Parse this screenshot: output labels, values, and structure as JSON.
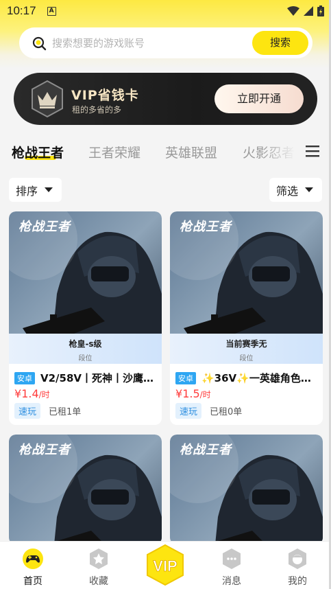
{
  "status_bar": {
    "time": "10:17",
    "notification_letter": "A"
  },
  "search": {
    "placeholder": "搜索想要的游戏账号",
    "button_label": "搜索"
  },
  "vip_card": {
    "title": "VIP省钱卡",
    "subtitle": "租的多省的多",
    "button_label": "立即开通"
  },
  "tabs": [
    {
      "label": "枪战王者",
      "active": true
    },
    {
      "label": "王者荣耀",
      "active": false
    },
    {
      "label": "英雄联盟",
      "active": false
    },
    {
      "label": "火影忍者",
      "active": false
    }
  ],
  "filters": {
    "sort_label": "排序",
    "filter_label": "筛选"
  },
  "cards": [
    {
      "cover_text": "枪战王者",
      "banner_title": "枪皇-s级",
      "banner_sub": "段位",
      "os": "安卓",
      "title": "V2/58V丨死神丨沙鹰…",
      "price_symbol": "¥",
      "price": "1.4",
      "price_unit": "/时",
      "tag": "速玩",
      "rented": "已租1单"
    },
    {
      "cover_text": "枪战王者",
      "banner_title": "当前赛季无",
      "banner_sub": "段位",
      "os": "安卓",
      "title": "✨36V✨一英雄角色…",
      "price_symbol": "¥",
      "price": "1.5",
      "price_unit": "/时",
      "tag": "速玩",
      "rented": "已租0单"
    },
    {
      "cover_text": "枪战王者"
    },
    {
      "cover_text": "枪战王者"
    }
  ],
  "bottom_nav": [
    {
      "label": "首页",
      "icon": "gamepad-icon",
      "active": true
    },
    {
      "label": "收藏",
      "icon": "star-icon",
      "active": false
    },
    {
      "label": "VIP",
      "icon": "vip-badge-icon",
      "active": false
    },
    {
      "label": "消息",
      "icon": "chat-bubble-icon",
      "active": false
    },
    {
      "label": "我的",
      "icon": "profile-face-icon",
      "active": false
    }
  ],
  "colors": {
    "accent_yellow": "#fde510",
    "price_red": "#ff3b3b",
    "os_badge_blue": "#2ea6f2"
  }
}
